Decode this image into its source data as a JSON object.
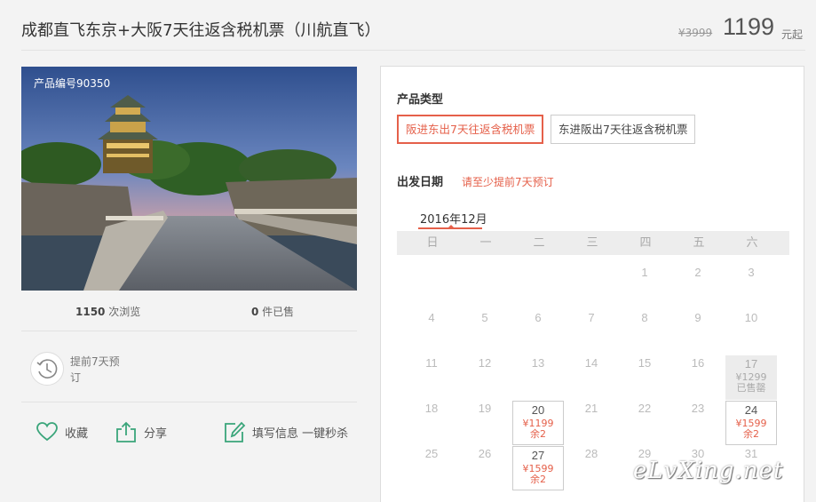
{
  "header": {
    "title": "成都直飞东京+大阪7天往返含税机票（川航直飞）",
    "original_price": "¥3999",
    "price": "1199",
    "price_unit": "元起"
  },
  "photo": {
    "product_code": "产品编号90350"
  },
  "stats": {
    "views_count": "1150",
    "views_label": " 次浏览",
    "sold_count": "0",
    "sold_label": " 件已售"
  },
  "advance_booking": {
    "text": "提前7天预订",
    "icon": "clock-history-icon"
  },
  "actions": [
    {
      "label": "收藏",
      "icon": "heart-icon"
    },
    {
      "label": "分享",
      "icon": "share-icon"
    },
    {
      "label": "填写信息 一键秒杀",
      "icon": "edit-icon"
    }
  ],
  "product_type": {
    "label": "产品类型",
    "options": [
      "阪进东出7天往返含税机票",
      "东进阪出7天往返含税机票"
    ],
    "selected_index": 0
  },
  "departure": {
    "label": "出发日期",
    "hint": "请至少提前7天预订"
  },
  "calendar": {
    "month": "2016年12月",
    "weekdays": [
      "日",
      "一",
      "二",
      "三",
      "四",
      "五",
      "六"
    ],
    "rows": [
      [
        {
          "d": ""
        },
        {
          "d": ""
        },
        {
          "d": ""
        },
        {
          "d": ""
        },
        {
          "d": "1"
        },
        {
          "d": "2"
        },
        {
          "d": "3"
        }
      ],
      [
        {
          "d": "4"
        },
        {
          "d": "5"
        },
        {
          "d": "6"
        },
        {
          "d": "7"
        },
        {
          "d": "8"
        },
        {
          "d": "9"
        },
        {
          "d": "10"
        }
      ],
      [
        {
          "d": "11"
        },
        {
          "d": "12"
        },
        {
          "d": "13"
        },
        {
          "d": "14"
        },
        {
          "d": "15"
        },
        {
          "d": "16"
        },
        {
          "d": "17",
          "price": "¥1299",
          "status": "已售罄",
          "state": "soldout"
        }
      ],
      [
        {
          "d": "18"
        },
        {
          "d": "19"
        },
        {
          "d": "20",
          "price": "¥1199",
          "status": "余2",
          "state": "avail"
        },
        {
          "d": "21"
        },
        {
          "d": "22"
        },
        {
          "d": "23"
        },
        {
          "d": "24",
          "price": "¥1599",
          "status": "余2",
          "state": "avail"
        }
      ],
      [
        {
          "d": "25"
        },
        {
          "d": "26"
        },
        {
          "d": "27",
          "price": "¥1599",
          "status": "余2",
          "state": "avail"
        },
        {
          "d": "28"
        },
        {
          "d": "29"
        },
        {
          "d": "30"
        },
        {
          "d": "31"
        }
      ]
    ]
  },
  "watermark": "eLvXing.net",
  "colors": {
    "accent": "#e5604a",
    "icon_green": "#3aa57a"
  }
}
